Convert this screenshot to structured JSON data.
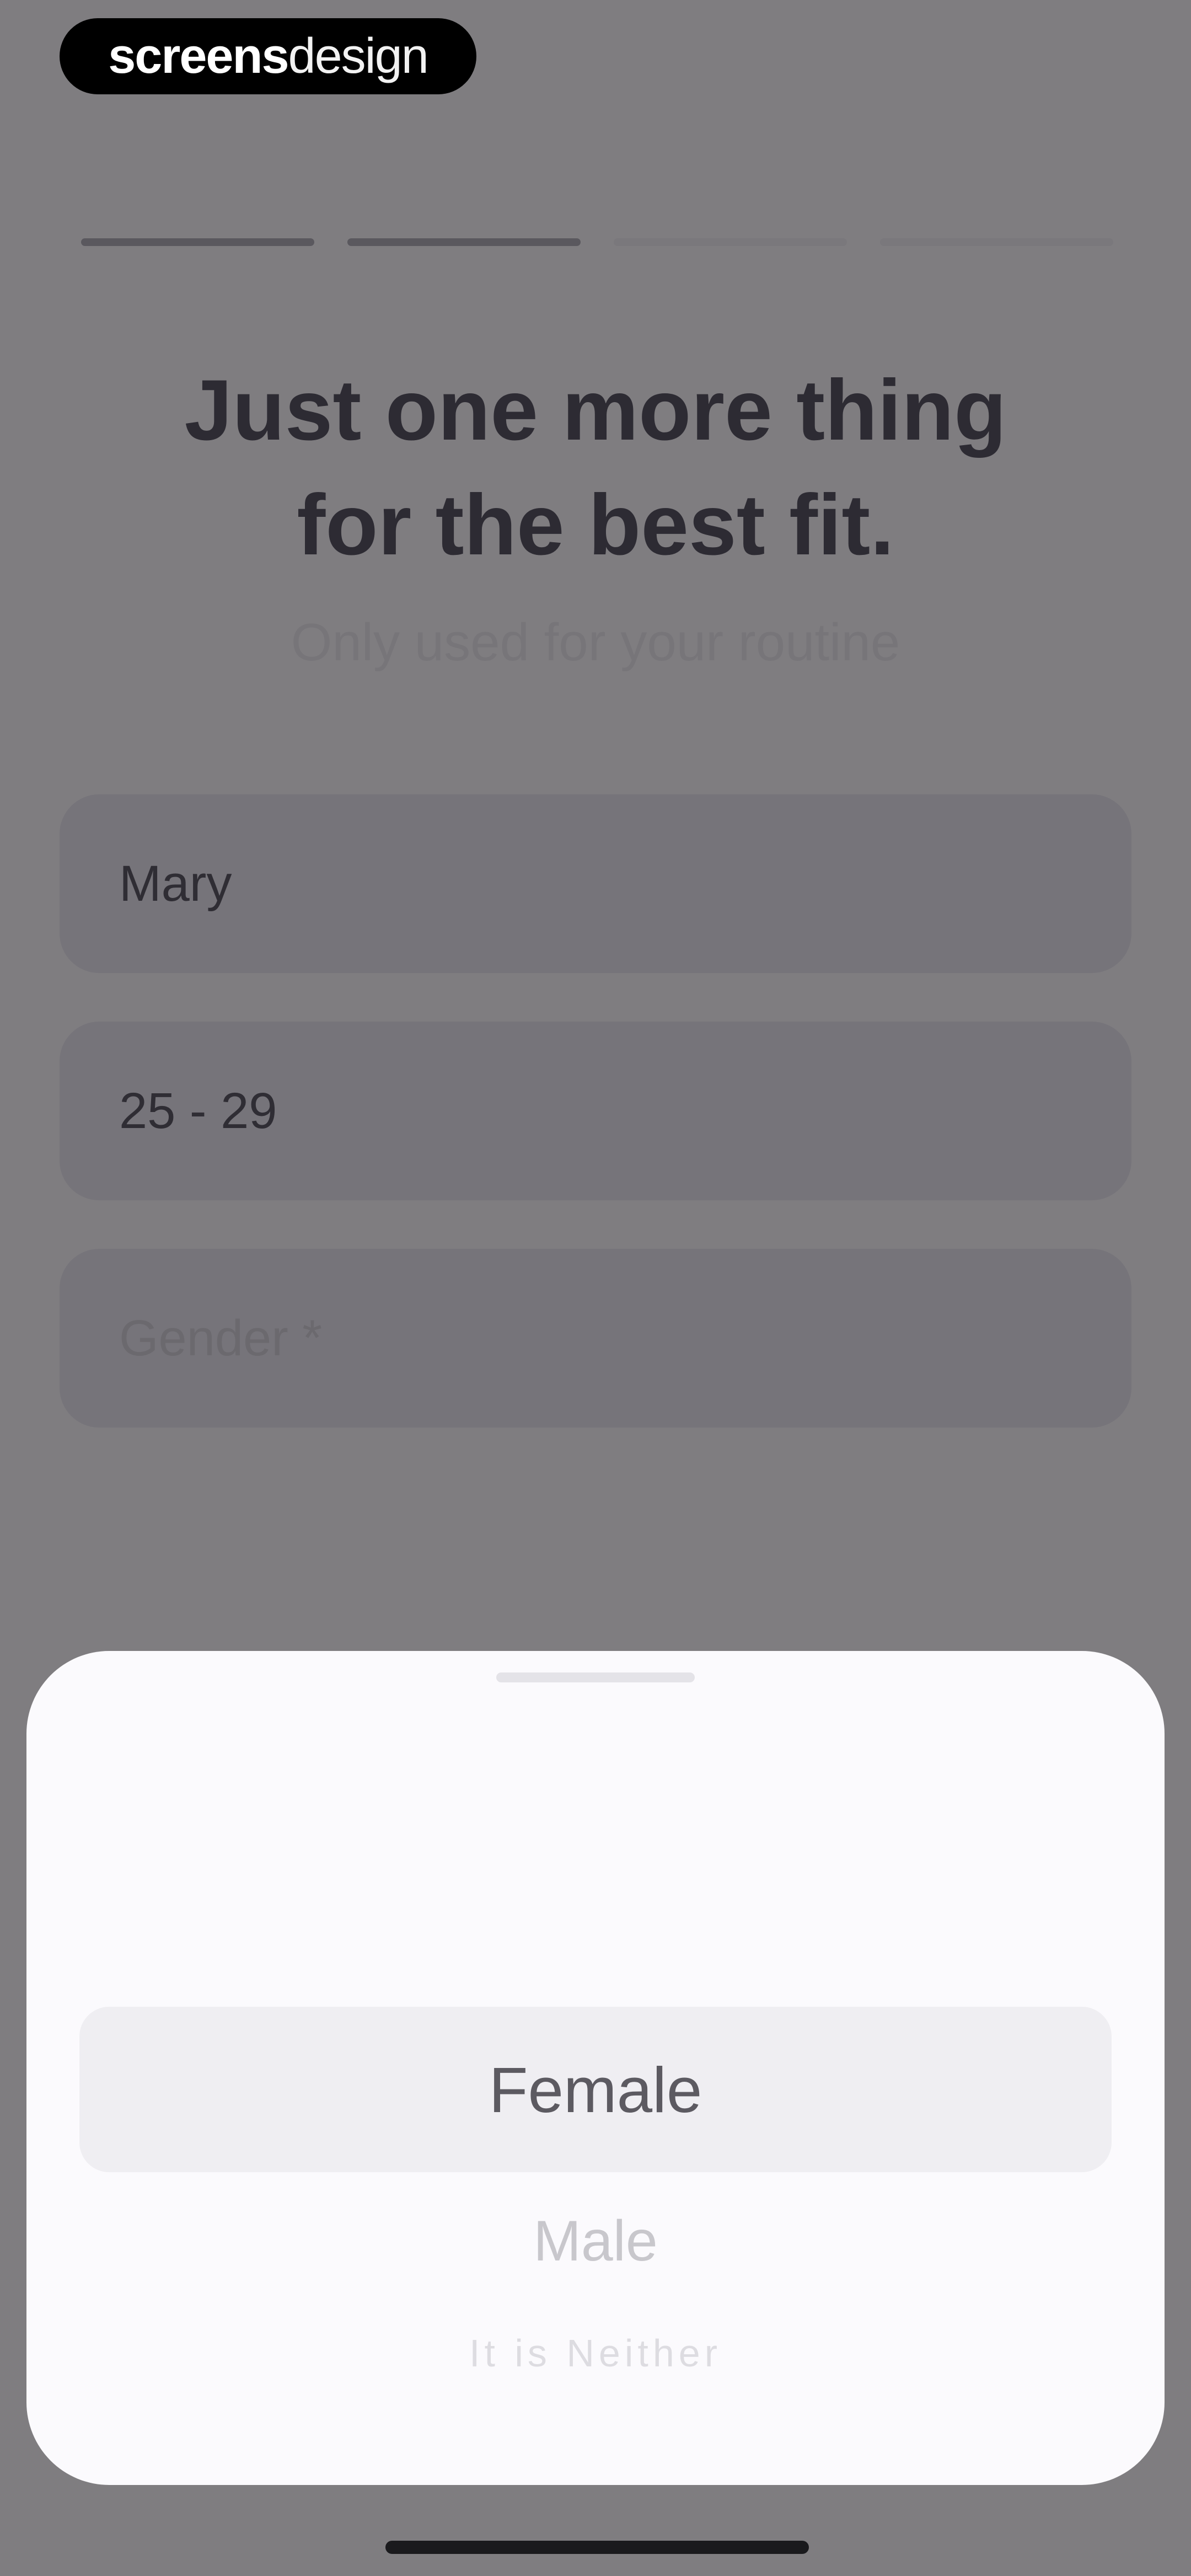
{
  "watermark": {
    "bold": "screens",
    "light": "design"
  },
  "progress": {
    "total_steps": 4,
    "completed_steps": 2
  },
  "header": {
    "title_line1": "Just one more thing",
    "title_line2": "for the best fit.",
    "subtitle": "Only used for your routine"
  },
  "form": {
    "name_value": "Mary",
    "age_value": "25 - 29",
    "gender_placeholder": "Gender *"
  },
  "gender_picker": {
    "options": [
      "Female",
      "Male",
      "It is Neither"
    ],
    "selected": "Female"
  },
  "colors": {
    "overlay_background": "#7f7d80",
    "sheet_background": "#fbfafd",
    "selection_band": "#efeef2"
  }
}
